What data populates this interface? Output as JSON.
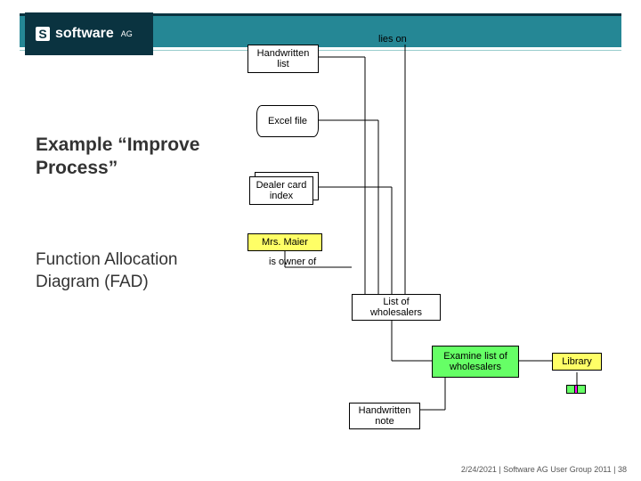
{
  "brand": {
    "name": "software",
    "suffix": "AG"
  },
  "title": "Example “Improve Process”",
  "subtitle": "Function Allocation Diagram (FAD)",
  "footer": {
    "date": "2/24/2021",
    "sep1": "  |  ",
    "event": "Software AG User Group 2011",
    "sep2": "  |  ",
    "page": "38"
  },
  "diagram": {
    "lies_on": "lies on",
    "handwritten_list": "Handwritten list",
    "excel_file": "Excel file",
    "dealer_card": "Dealer card index",
    "mrs_maier": "Mrs. Maier",
    "is_owner": "is owner of",
    "list_wholesalers": "List of wholesalers",
    "examine": "Examine list of wholesalers",
    "library": "Library",
    "handwritten_note": "Handwritten note"
  }
}
